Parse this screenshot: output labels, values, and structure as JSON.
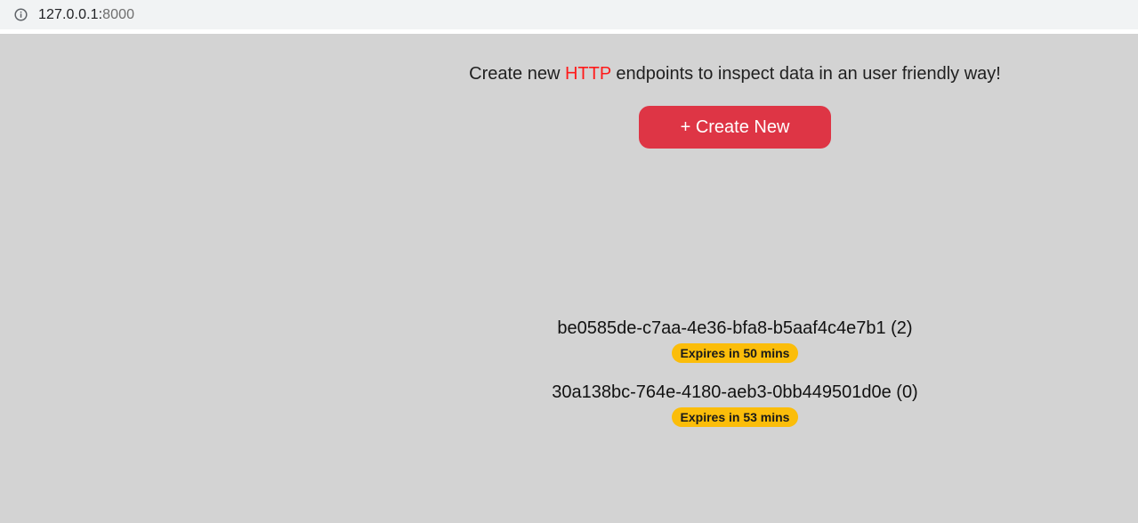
{
  "browser": {
    "url_host": "127.0.0.1:",
    "url_port": "8000",
    "info_icon": "info-circle-icon"
  },
  "hero": {
    "tagline_before": "Create new ",
    "tagline_accent": "HTTP",
    "tagline_after": " endpoints to inspect data in an user friendly way!",
    "create_button_label": "+ Create New"
  },
  "endpoints": [
    {
      "title": "be0585de-c7aa-4e36-bfa8-b5aaf4c4e7b1 (2)",
      "expiry": "Expires in 50 mins"
    },
    {
      "title": "30a138bc-764e-4180-aeb3-0bb449501d0e (0)",
      "expiry": "Expires in 53 mins"
    }
  ],
  "colors": {
    "background": "#d3d3d3",
    "accent_text": "#ff1a1a",
    "button": "#de3545",
    "badge": "#fbbd0a"
  }
}
